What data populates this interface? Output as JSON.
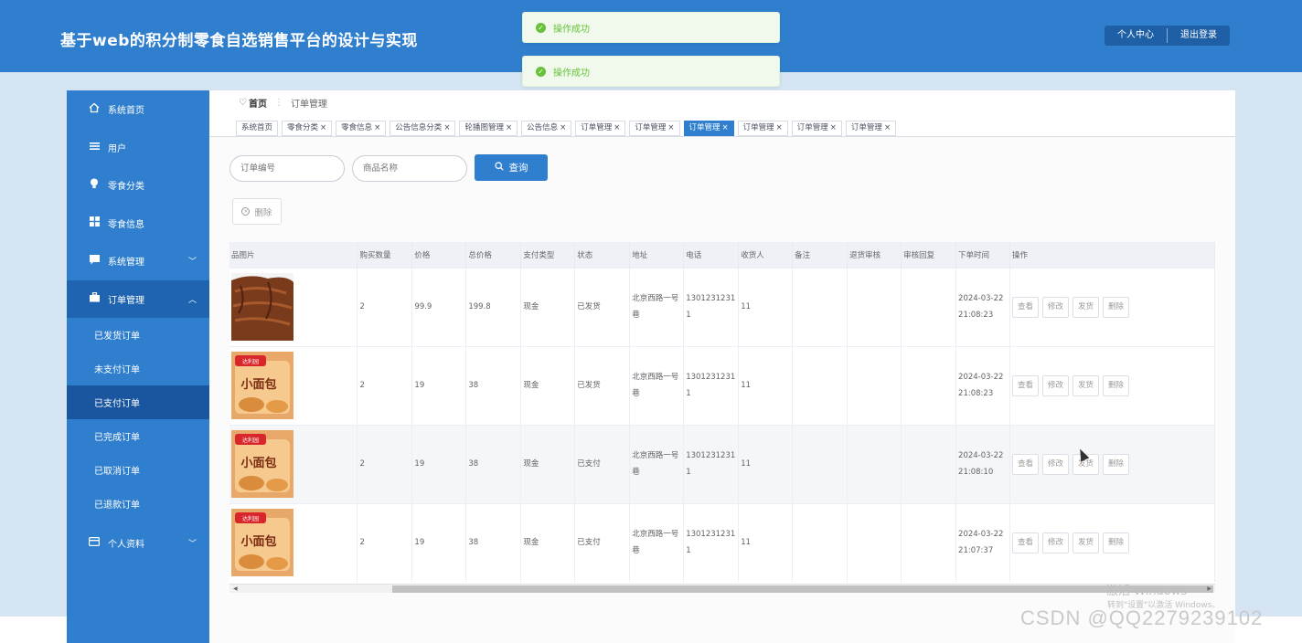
{
  "header": {
    "title": "基于web的积分制零食自选销售平台的设计与实现",
    "profile_btn": "个人中心",
    "logout_btn": "退出登录",
    "brand_color": "#2f7fce"
  },
  "toasts": [
    "操作成功",
    "操作成功"
  ],
  "sidebar": {
    "items": [
      {
        "label": "系统首页",
        "icon": "home-icon"
      },
      {
        "label": "用户",
        "icon": "list-icon"
      },
      {
        "label": "零食分类",
        "icon": "bulb-icon"
      },
      {
        "label": "零食信息",
        "icon": "grid-icon"
      },
      {
        "label": "系统管理",
        "icon": "chat-icon"
      },
      {
        "label": "订单管理",
        "icon": "briefcase-icon"
      }
    ],
    "sub_items": [
      "已发货订单",
      "未支付订单",
      "已支付订单",
      "已完成订单",
      "已取消订单",
      "已退款订单"
    ],
    "active_sub": "已支付订单",
    "profile": {
      "label": "个人资料",
      "icon": "card-icon"
    }
  },
  "breadcrumb": {
    "home": "首页",
    "current": "订单管理"
  },
  "tabs": [
    {
      "label": "系统首页",
      "closable": false
    },
    {
      "label": "零食分类",
      "closable": true
    },
    {
      "label": "零食信息",
      "closable": true
    },
    {
      "label": "公告信息分类",
      "closable": true
    },
    {
      "label": "轮播图管理",
      "closable": true
    },
    {
      "label": "公告信息",
      "closable": true
    },
    {
      "label": "订单管理",
      "closable": true
    },
    {
      "label": "订单管理",
      "closable": true
    },
    {
      "label": "订单管理",
      "closable": true,
      "active": true
    },
    {
      "label": "订单管理",
      "closable": true
    },
    {
      "label": "订单管理",
      "closable": true
    },
    {
      "label": "订单管理",
      "closable": true
    }
  ],
  "search": {
    "order_no_placeholder": "订单编号",
    "product_placeholder": "商品名称",
    "query_label": "查询"
  },
  "actions": {
    "delete_label": "删除"
  },
  "table": {
    "columns": [
      "品图片",
      "购买数量",
      "价格",
      "总价格",
      "支付类型",
      "状态",
      "地址",
      "电话",
      "收货人",
      "备注",
      "退货审核",
      "审核回复",
      "下单时间",
      "操作"
    ],
    "rows": [
      {
        "image": "jerky",
        "qty": "2",
        "price": "99.9",
        "total": "199.8",
        "pay": "现金",
        "status": "已发货",
        "addr1": "北京西路一号",
        "addr2": "巷",
        "tel1": "1301231231",
        "tel2": "1",
        "receiver": "11",
        "note": "",
        "return": "",
        "reply": "",
        "date": "2024-03-22",
        "time": "21:08:23"
      },
      {
        "image": "bread",
        "qty": "2",
        "price": "19",
        "total": "38",
        "pay": "现金",
        "status": "已发货",
        "addr1": "北京西路一号",
        "addr2": "巷",
        "tel1": "1301231231",
        "tel2": "1",
        "receiver": "11",
        "note": "",
        "return": "",
        "reply": "",
        "date": "2024-03-22",
        "time": "21:08:23"
      },
      {
        "image": "bread",
        "qty": "2",
        "price": "19",
        "total": "38",
        "pay": "现金",
        "status": "已支付",
        "addr1": "北京西路一号",
        "addr2": "巷",
        "tel1": "1301231231",
        "tel2": "1",
        "receiver": "11",
        "note": "",
        "return": "",
        "reply": "",
        "date": "2024-03-22",
        "time": "21:08:10"
      },
      {
        "image": "bread",
        "qty": "2",
        "price": "19",
        "total": "38",
        "pay": "现金",
        "status": "已支付",
        "addr1": "北京西路一号",
        "addr2": "巷",
        "tel1": "1301231231",
        "tel2": "1",
        "receiver": "11",
        "note": "",
        "return": "",
        "reply": "",
        "date": "2024-03-22",
        "time": "21:07:37"
      }
    ],
    "row_buttons": [
      "查看",
      "修改",
      "发货",
      "删除"
    ]
  },
  "watermarks": {
    "windows_title": "激活 Windows",
    "windows_sub": "转到\"设置\"以激活 Windows。",
    "csdn": "CSDN @QQ2279239102"
  }
}
